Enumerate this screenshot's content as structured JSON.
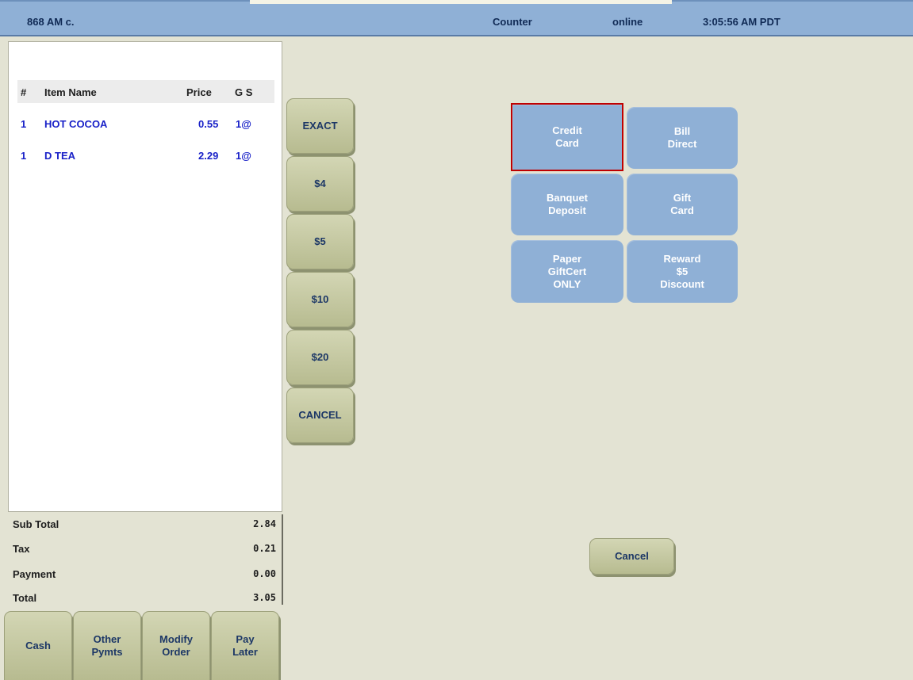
{
  "header": {
    "order": "868 AM c.",
    "mode": "Counter",
    "status": "online",
    "time": "3:05:56 AM PDT"
  },
  "items": {
    "columns": {
      "qty": "#",
      "name": "Item Name",
      "price": "Price",
      "gs": "G S"
    },
    "rows": [
      {
        "qty": "1",
        "name": "HOT COCOA",
        "price": "0.55",
        "gs": "1@"
      },
      {
        "qty": "1",
        "name": "D TEA",
        "price": "2.29",
        "gs": "1@"
      }
    ]
  },
  "totals": {
    "subtotal_label": "Sub Total",
    "subtotal": "2.84",
    "tax_label": "Tax",
    "tax": "0.21",
    "payment_label": "Payment",
    "payment": "0.00",
    "total_label": "Total",
    "total": "3.05"
  },
  "quick_cash": [
    "EXACT",
    "$4",
    "$5",
    "$10",
    "$20",
    "CANCEL"
  ],
  "payment_types": {
    "credit_card": [
      "Credit",
      "Card"
    ],
    "bill_direct": [
      "Bill",
      "Direct"
    ],
    "banquet_deposit": [
      "Banquet",
      "Deposit"
    ],
    "gift_card": [
      "Gift",
      "Card"
    ],
    "paper_giftcert": [
      "Paper",
      "GiftCert",
      "ONLY"
    ],
    "reward_discount": [
      "Reward",
      "$5",
      "Discount"
    ],
    "selected": "credit_card"
  },
  "cancel_label": "Cancel",
  "bottom_buttons": {
    "cash": [
      "Cash"
    ],
    "other_pymts": [
      "Other",
      "Pymts"
    ],
    "modify_order": [
      "Modify",
      "Order"
    ],
    "pay_later": [
      "Pay",
      "Later"
    ]
  },
  "colors": {
    "background": "#e3e3d3",
    "header": "#8fb0d6",
    "payment_button": "#8fb0d6",
    "selected_outline": "#c00000",
    "item_text": "#1a22c8",
    "olive_button": "#c7caa4"
  }
}
